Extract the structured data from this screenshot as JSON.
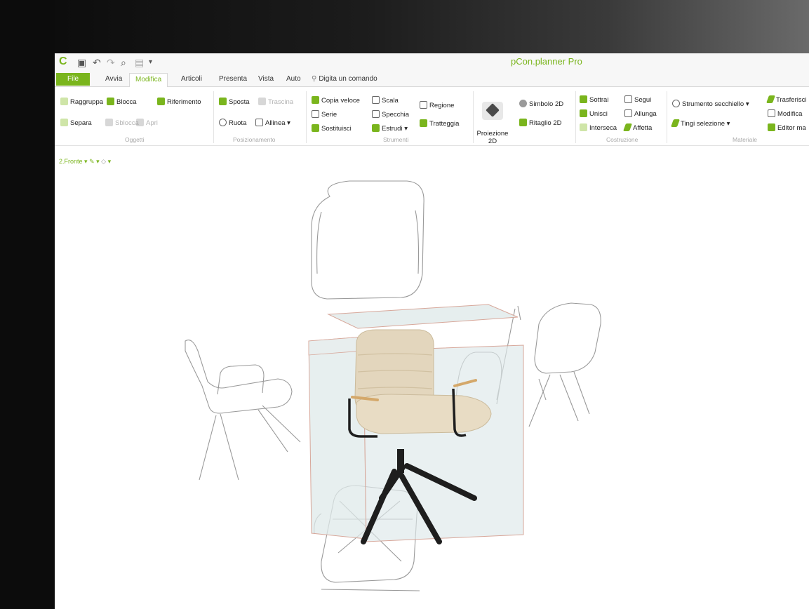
{
  "window": {
    "title": "pCon.planner Pro"
  },
  "quick_access": [
    {
      "icon": "app-logo-icon",
      "glyph": "C"
    },
    {
      "icon": "save-icon",
      "glyph": "▣"
    },
    {
      "icon": "undo-icon",
      "glyph": "↶"
    },
    {
      "icon": "redo-icon",
      "glyph": "↷"
    },
    {
      "icon": "snapshot-icon",
      "glyph": "⌕"
    },
    {
      "icon": "print-icon",
      "glyph": "▤"
    },
    {
      "icon": "customize-icon",
      "glyph": "▾"
    }
  ],
  "tabs": [
    {
      "label": "File",
      "kind": "file"
    },
    {
      "label": "Avvia",
      "kind": "normal"
    },
    {
      "label": "Modifica",
      "kind": "active"
    },
    {
      "label": "Articoli",
      "kind": "normal"
    },
    {
      "label": "Presenta",
      "kind": "normal"
    },
    {
      "label": "Vista",
      "kind": "normal"
    },
    {
      "label": "Auto",
      "kind": "normal"
    }
  ],
  "command_search": {
    "label": "Digita un comando",
    "icon": "pin-icon"
  },
  "ribbon": {
    "oggetti": {
      "label": "Oggetti",
      "raggruppa": "Raggruppa",
      "blocca": "Blocca",
      "separa": "Separa",
      "sblocca": "Sblocca",
      "apri": "Apri"
    },
    "riferimento": {
      "label": "Riferimento"
    },
    "posizionamento": {
      "label": "Posizionamento",
      "sposta": "Sposta",
      "trascina": "Trascina",
      "ruota": "Ruota",
      "allinea": "Allinea"
    },
    "strumenti": {
      "label": "Strumenti",
      "copia_veloce": "Copia veloce",
      "scala": "Scala",
      "serie": "Serie",
      "specchia": "Specchia",
      "sostituisci": "Sostituisci",
      "estrudi": "Estrudi",
      "regione": "Regione",
      "tratteggia": "Tratteggia"
    },
    "proiezione": {
      "label": "Proiezione\n2D"
    },
    "simbolo": {
      "simbolo_2d": "Simbolo 2D",
      "ritaglio_2d": "Ritaglio 2D"
    },
    "costruzione": {
      "label": "Costruzione",
      "sottrai": "Sottrai",
      "segui": "Segui",
      "unisci": "Unisci",
      "allunga": "Allunga",
      "interseca": "Interseca",
      "affetta": "Affetta"
    },
    "materiale": {
      "label": "Materiale",
      "strumento_secchiello": "Strumento secchiello",
      "tingi_selezione": "Tingi selezione",
      "trasferisci": "Trasferisci",
      "modifica": "Modifica",
      "editor_ma": "Editor ma"
    }
  },
  "view_bar": {
    "label": "2.Fronte"
  },
  "colors": {
    "brand_green": "#7ab51d",
    "chair_fabric": "#e3d6bd",
    "chair_frame": "#1e1e1e",
    "armrest_wood": "#d4a86a",
    "desk_glass": "#dfe9ea",
    "desk_edge": "#d7a79a",
    "wireframe": "#9a9a9a"
  }
}
